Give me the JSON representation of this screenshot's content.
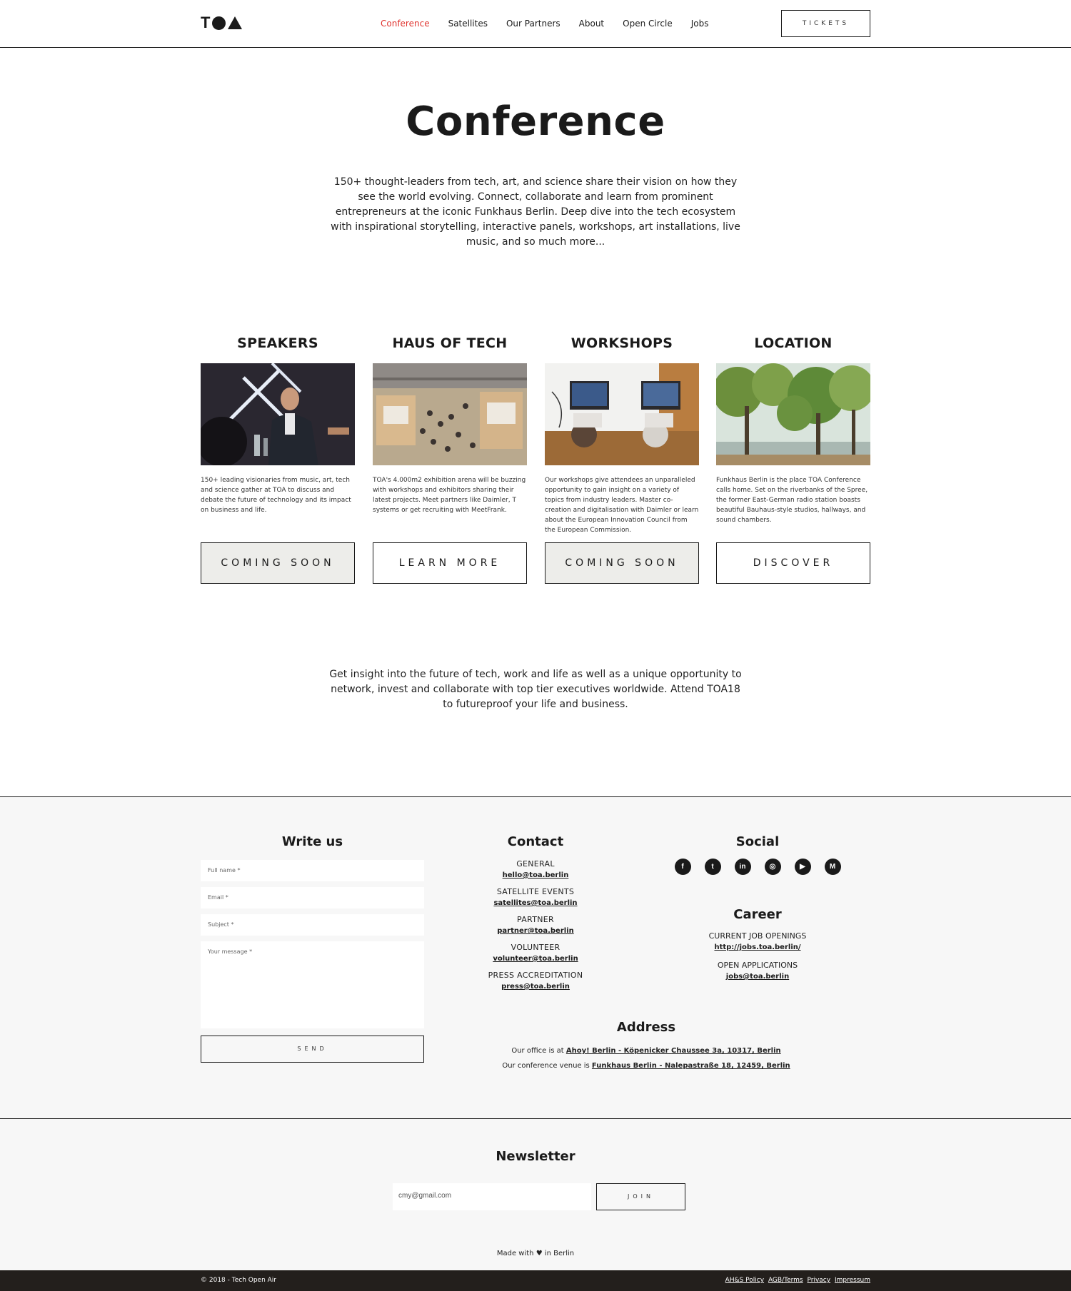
{
  "header": {
    "logo": "TOA",
    "nav": [
      "Conference",
      "Satellites",
      "Our Partners",
      "About",
      "Open Circle",
      "Jobs"
    ],
    "active_nav": "Conference",
    "tickets_label": "TICKETS"
  },
  "hero": {
    "title": "Conference",
    "text": "150+ thought-leaders from tech, art, and science share their vision on how they see the world evolving. Connect, collaborate and learn from prominent entrepreneurs at the iconic Funkhaus Berlin. Deep dive into the tech ecosystem with inspirational storytelling, interactive panels, workshops, art installations, live music, and so much more..."
  },
  "cards": [
    {
      "title": "SPEAKERS",
      "image": "speaker-on-stage-photo",
      "desc": "150+ leading visionaries from music, art, tech and science gather at TOA to discuss and debate the future of technology and its impact on business and life.",
      "button": "COMING SOON"
    },
    {
      "title": "HAUS OF TECH",
      "image": "exhibition-hall-photo",
      "desc": "TOA's 4.000m2 exhibition arena will be buzzing with workshops and exhibitors sharing their latest projects. Meet partners like Daimler, T systems or get recruiting with MeetFrank.",
      "button": "LEARN MORE"
    },
    {
      "title": "WORKSHOPS",
      "image": "workshop-laptops-photo",
      "desc": "Our workshops give attendees an unparalleled opportunity to gain insight on a variety of topics from industry leaders. Master co-creation and digitalisation with Daimler or learn about the European Innovation Council from the European Commission.",
      "button": "COMING SOON"
    },
    {
      "title": "LOCATION",
      "image": "riverbank-trees-photo",
      "desc": "Funkhaus Berlin is the place TOA Conference calls home. Set on the riverbanks of the Spree, the former East-German radio station boasts beautiful Bauhaus-style studios, hallways, and sound chambers.",
      "button": "DISCOVER"
    }
  ],
  "insight": "Get insight into the future of tech, work and life as well as a unique opportunity to network, invest and collaborate with top tier executives worldwide. Attend TOA18 to futureproof your life and business.",
  "write_us": {
    "title": "Write us",
    "fields": [
      "Full name *",
      "Email *",
      "Subject *",
      "Your message *"
    ],
    "send": "SEND"
  },
  "contact": {
    "title": "Contact",
    "items": [
      {
        "label": "GENERAL",
        "email": "hello@toa.berlin"
      },
      {
        "label": "SATELLITE EVENTS",
        "email": "satellites@toa.berlin"
      },
      {
        "label": "PARTNER",
        "email": "partner@toa.berlin"
      },
      {
        "label": "VOLUNTEER",
        "email": "volunteer@toa.berlin"
      },
      {
        "label": "PRESS ACCREDITATION",
        "email": "press@toa.berlin"
      }
    ]
  },
  "social": {
    "title": "Social",
    "icons": [
      "facebook-icon",
      "twitter-icon",
      "linkedin-icon",
      "instagram-icon",
      "youtube-icon",
      "medium-icon"
    ]
  },
  "career": {
    "title": "Career",
    "items": [
      {
        "label": "CURRENT JOB OPENINGS",
        "link": "http://jobs.toa.berlin/"
      },
      {
        "label": "OPEN APPLICATIONS",
        "link": "jobs@toa.berlin"
      }
    ]
  },
  "address": {
    "title": "Address",
    "office_prefix": "Our office is at ",
    "office": "Ahoy! Berlin - Köpenicker Chaussee 3a, 10317, Berlin",
    "venue_prefix": "Our conference venue is ",
    "venue": "Funkhaus Berlin - Nalepastraße 18, 12459, Berlin"
  },
  "newsletter": {
    "title": "Newsletter",
    "email_value": "cmy@gmail.com",
    "join": "JOIN",
    "made_prefix": "Made with ",
    "heart": "♥",
    "made_suffix": " in Berlin"
  },
  "bottom": {
    "copyright": "© 2018 - Tech Open Air",
    "links": [
      "AH&S Policy",
      "AGB/Terms",
      "Privacy",
      "Impressum"
    ]
  }
}
